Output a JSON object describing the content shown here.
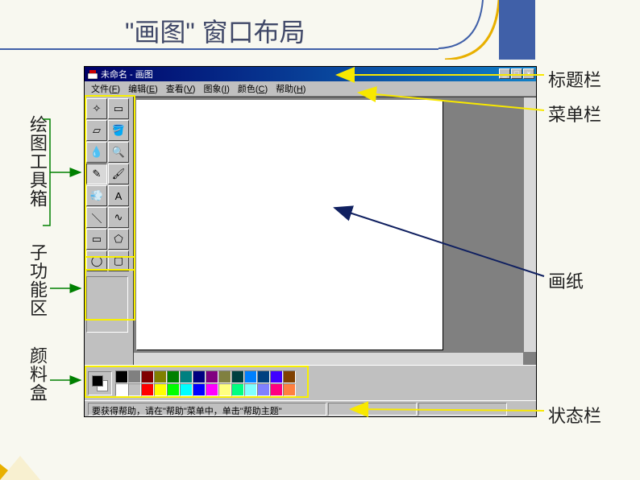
{
  "slide_title": "\"画图\" 窗口布局",
  "labels": {
    "toolbox": "绘图工具箱",
    "subarea": "子功能区",
    "palette": "颜料盒",
    "titlebar": "标题栏",
    "menubar": "菜单栏",
    "canvas": "画纸",
    "statusbar": "状态栏"
  },
  "app": {
    "title": "未命名 - 画图",
    "menus": [
      {
        "label": "文件",
        "key": "F"
      },
      {
        "label": "编辑",
        "key": "E"
      },
      {
        "label": "查看",
        "key": "V"
      },
      {
        "label": "图象",
        "key": "I"
      },
      {
        "label": "颜色",
        "key": "C"
      },
      {
        "label": "帮助",
        "key": "H"
      }
    ],
    "status_text": "要获得帮助，请在\"帮助\"菜单中，单击\"帮助主题\"",
    "tools": [
      "free-select",
      "rect-select",
      "eraser",
      "fill",
      "eyedropper",
      "magnifier",
      "pencil",
      "brush",
      "airbrush",
      "text",
      "line",
      "curve",
      "rect",
      "polygon",
      "ellipse",
      "rounded-rect"
    ],
    "tool_glyphs": {
      "free-select": "✧",
      "rect-select": "▭",
      "eraser": "▱",
      "fill": "🪣",
      "eyedropper": "💧",
      "magnifier": "🔍",
      "pencil": "✎",
      "brush": "🖌",
      "airbrush": "💨",
      "text": "A",
      "line": "＼",
      "curve": "∿",
      "rect": "▭",
      "polygon": "⬠",
      "ellipse": "◯",
      "rounded-rect": "▢"
    },
    "palette_row1": [
      "#000000",
      "#808080",
      "#800000",
      "#808000",
      "#008000",
      "#008080",
      "#000080",
      "#800080",
      "#808040",
      "#004040",
      "#0080ff",
      "#004080",
      "#4000ff",
      "#804000"
    ],
    "palette_row2": [
      "#ffffff",
      "#c0c0c0",
      "#ff0000",
      "#ffff00",
      "#00ff00",
      "#00ffff",
      "#0000ff",
      "#ff00ff",
      "#ffff80",
      "#00ff80",
      "#80ffff",
      "#8080ff",
      "#ff0080",
      "#ff8040"
    ]
  }
}
